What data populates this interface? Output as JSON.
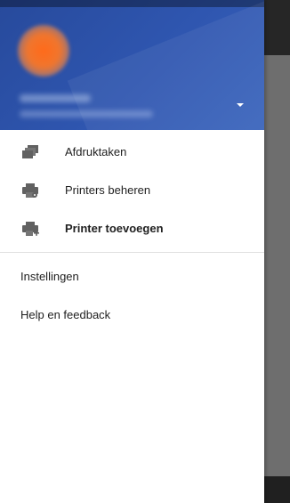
{
  "drawer": {
    "header": {
      "account_dropdown_icon": "caret-down-icon"
    },
    "items": [
      {
        "label": "Afdruktaken",
        "icon": "print-jobs-icon"
      },
      {
        "label": "Printers beheren",
        "icon": "printer-settings-icon"
      },
      {
        "label": "Printer toevoegen",
        "icon": "add-printer-icon"
      }
    ],
    "secondary_items": [
      {
        "label": "Instellingen"
      },
      {
        "label": "Help en feedback"
      }
    ]
  },
  "colors": {
    "header_blue": "#2f56b0",
    "avatar_orange": "#f0762e",
    "icon_gray": "#616161",
    "scrim": "#6e6e6e"
  }
}
